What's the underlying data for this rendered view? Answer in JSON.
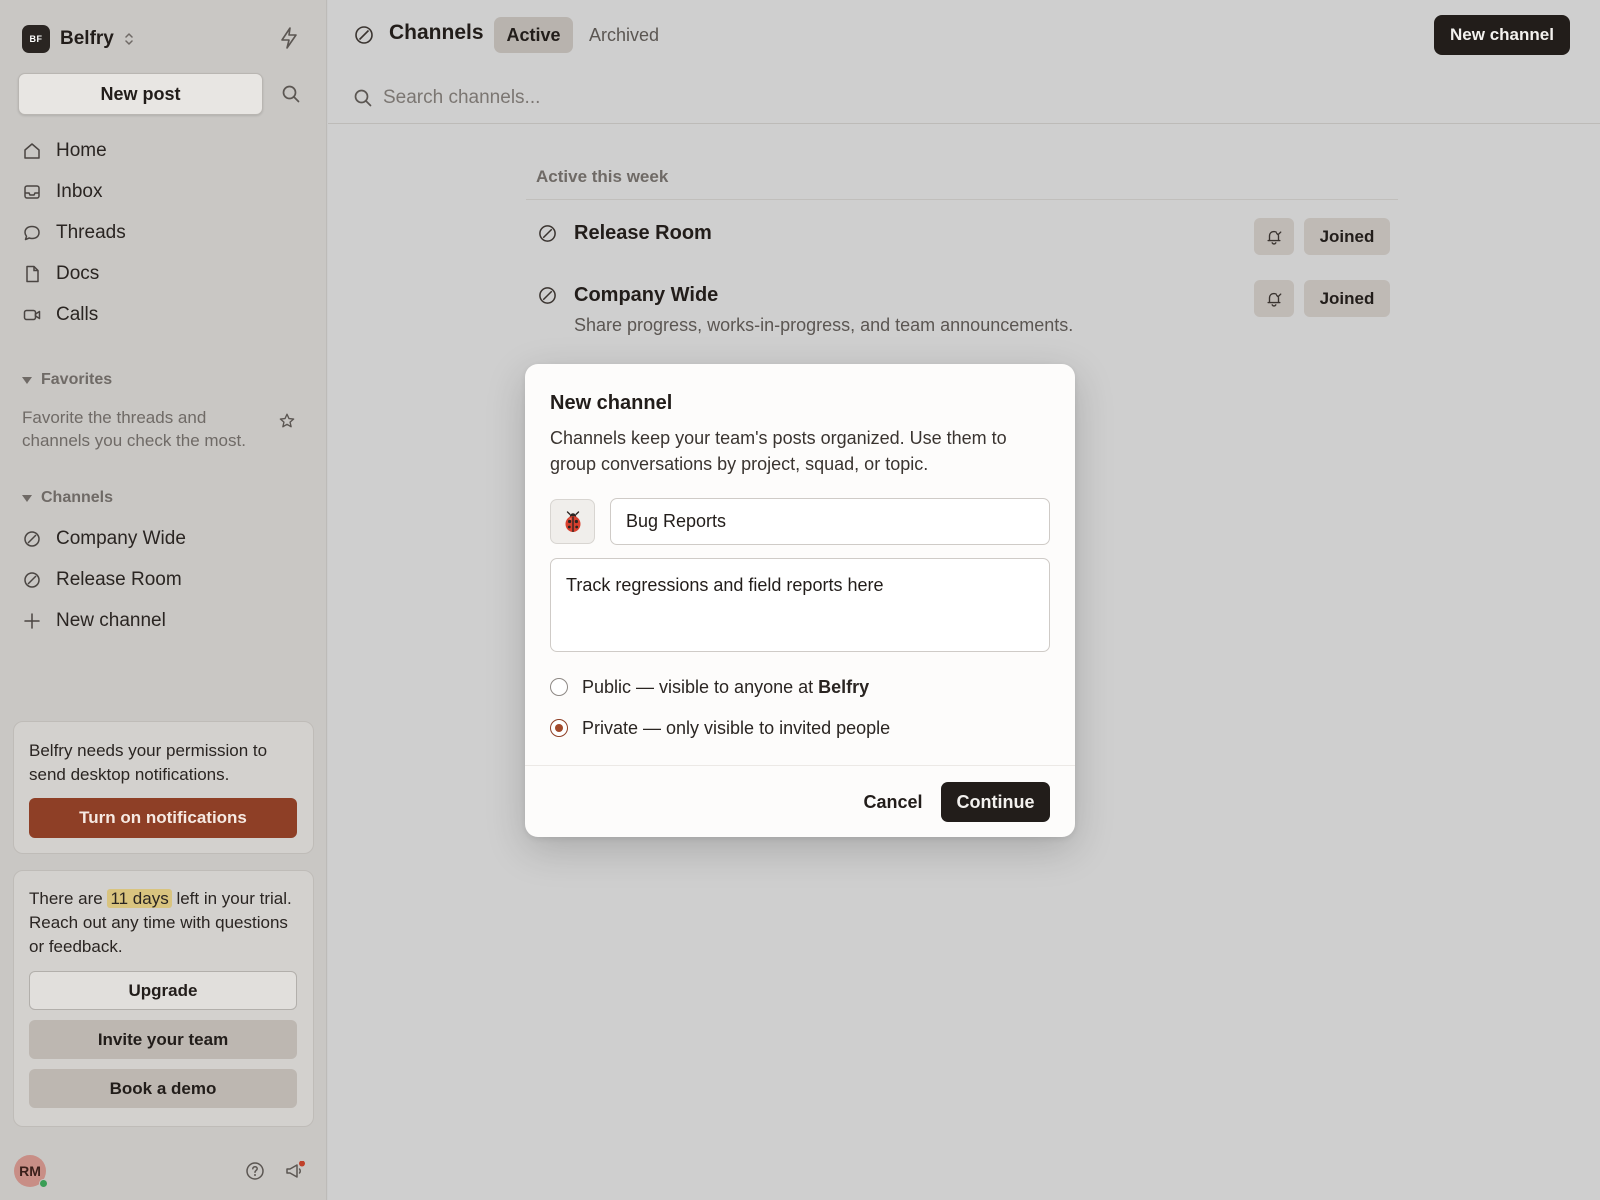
{
  "workspace": {
    "initials": "BF",
    "name": "Belfry"
  },
  "sidebar": {
    "new_post": "New post",
    "nav": [
      {
        "label": "Home",
        "icon": "home-icon"
      },
      {
        "label": "Inbox",
        "icon": "inbox-icon"
      },
      {
        "label": "Threads",
        "icon": "threads-icon"
      },
      {
        "label": "Docs",
        "icon": "docs-icon"
      },
      {
        "label": "Calls",
        "icon": "calls-icon"
      }
    ],
    "favorites": {
      "heading": "Favorites",
      "empty_text": "Favorite the threads and channels you check the most."
    },
    "channels": {
      "heading": "Channels",
      "items": [
        {
          "label": "Company Wide"
        },
        {
          "label": "Release Room"
        }
      ],
      "new_channel": "New channel"
    },
    "notify_card": {
      "text": "Belfry needs your permission to send desktop notifications.",
      "button": "Turn on notifications"
    },
    "trial_card": {
      "text_before": "There are ",
      "days": "11 days",
      "text_after": " left in your trial. Reach out any time with questions or feedback.",
      "upgrade": "Upgrade",
      "invite": "Invite your team",
      "demo": "Book a demo"
    },
    "user": {
      "initials": "RM"
    }
  },
  "main": {
    "title": "Channels",
    "tabs": [
      {
        "label": "Active"
      },
      {
        "label": "Archived"
      }
    ],
    "new_channel_button": "New channel",
    "search_placeholder": "Search channels...",
    "list_heading": "Active this week",
    "channels": [
      {
        "name": "Release Room",
        "description": "",
        "status": "Joined"
      },
      {
        "name": "Company Wide",
        "description": "Share progress, works-in-progress, and team announcements.",
        "status": "Joined"
      }
    ]
  },
  "modal": {
    "title": "New channel",
    "description": "Channels keep your team's posts organized. Use them to group conversations by project, squad, or topic.",
    "emoji": "🐞",
    "name_value": "Bug Reports",
    "description_value": "Track regressions and field reports here",
    "public_label_prefix": "Public — visible to anyone at ",
    "public_label_org": "Belfry",
    "private_label": "Private — only visible to invited people",
    "selected_visibility": "private",
    "cancel": "Cancel",
    "continue": "Continue"
  },
  "colors": {
    "accent": "#8e3f26",
    "dark_button": "#221d1a",
    "highlight": "#d9c47f"
  }
}
